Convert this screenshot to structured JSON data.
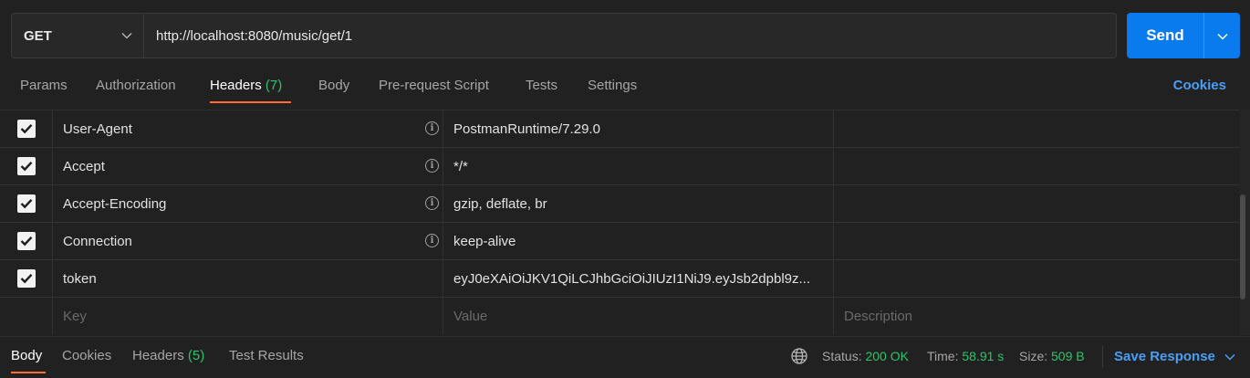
{
  "request": {
    "method": "GET",
    "url": "http://localhost:8080/music/get/1",
    "send_label": "Send"
  },
  "tabs": {
    "params": "Params",
    "authorization": "Authorization",
    "headers": "Headers",
    "headers_count": "(7)",
    "body": "Body",
    "prerequest": "Pre-request Script",
    "tests": "Tests",
    "settings": "Settings",
    "cookies": "Cookies"
  },
  "headers": [
    {
      "key": "User-Agent",
      "value": "PostmanRuntime/7.29.0",
      "checked": true
    },
    {
      "key": "Accept",
      "value": "*/*",
      "checked": true
    },
    {
      "key": "Accept-Encoding",
      "value": "gzip, deflate, br",
      "checked": true
    },
    {
      "key": "Connection",
      "value": "keep-alive",
      "checked": true
    },
    {
      "key": "token",
      "value": "eyJ0eXAiOiJKV1QiLCJhbGciOiJIUzI1NiJ9.eyJsb2dpbl9z...",
      "checked": true
    }
  ],
  "placeholders": {
    "key": "Key",
    "value": "Value",
    "description": "Description"
  },
  "response": {
    "tabs": {
      "body": "Body",
      "cookies": "Cookies",
      "headers": "Headers",
      "headers_count": "(5)",
      "test_results": "Test Results"
    },
    "status_label": "Status:",
    "status_value": "200 OK",
    "time_label": "Time:",
    "time_value": "58.91 s",
    "size_label": "Size:",
    "size_value": "509 B",
    "save_label": "Save Response"
  },
  "colors": {
    "accent_orange": "#ff6c37",
    "send_blue": "#097bed",
    "link_blue": "#4a9ff5",
    "success_green": "#2ec46a"
  },
  "icons": {
    "method_dropdown": "chevron-down-icon",
    "send_dropdown": "chevron-down-icon",
    "checkbox": "checkmark-icon",
    "info": "info-icon",
    "network": "globe-icon"
  }
}
